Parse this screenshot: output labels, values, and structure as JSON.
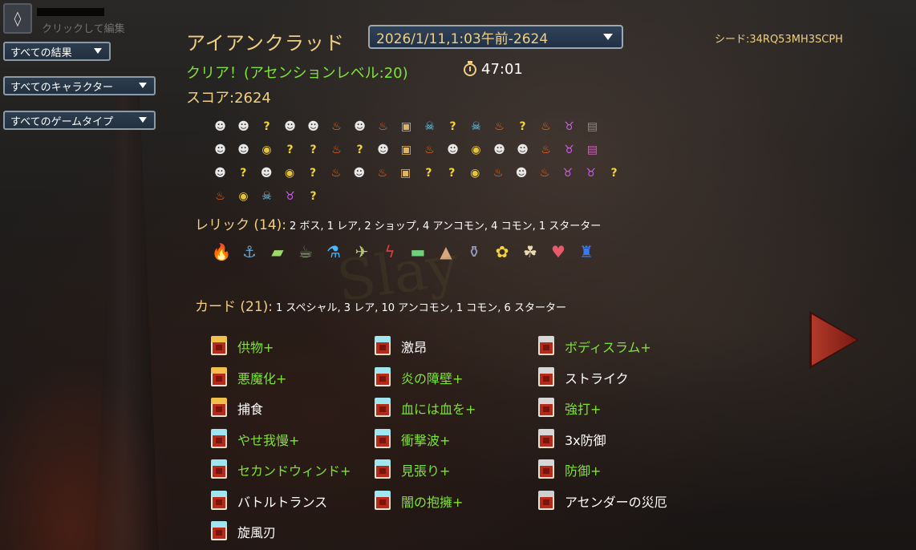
{
  "profile": {
    "edit_hint": "クリックして編集"
  },
  "filters": [
    {
      "label": "すべての結果"
    },
    {
      "label": "すべてのキャラクター"
    },
    {
      "label": "すべてのゲームタイプ"
    }
  ],
  "run": {
    "character": "アイアンクラッド",
    "selected_run": "2026/1/11,1:03午前-2624",
    "seed": "シード:34RQ53MH3SCPH",
    "result": "クリア！(アセンションレベル:20)",
    "time": "47:01",
    "score": "スコア:2624"
  },
  "path_rows": [
    [
      "monster",
      "monster",
      "unknown",
      "monster",
      "monster",
      "rest",
      "monster",
      "rest",
      "treasure",
      "elite",
      "unknown",
      "elite",
      "rest",
      "unknown-monster",
      "rest",
      "boss",
      "chest"
    ],
    [
      "monster",
      "monster",
      "shop",
      "unknown",
      "unknown",
      "rest",
      "unknown",
      "monster",
      "treasure",
      "rest",
      "monster",
      "shop",
      "monster",
      "monster",
      "rest",
      "boss",
      "chest"
    ],
    [
      "monster",
      "unknown",
      "monster",
      "shop",
      "unknown",
      "rest",
      "monster",
      "rest",
      "treasure",
      "unknown",
      "unknown",
      "shop",
      "rest",
      "monster",
      "rest",
      "boss",
      "boss",
      "unknown"
    ],
    [
      "rest",
      "shop",
      "elite",
      "boss",
      "unknown"
    ]
  ],
  "relics_section": {
    "label": "レリック (14):",
    "detail": "2 ボス, 1 レア, 2 ショップ, 4 アンコモン, 4 コモン, 1 スターター"
  },
  "relics": [
    "burning-blood-relic",
    "anchor-relic",
    "gold-bar-relic",
    "teapot-relic",
    "potion-relic",
    "bird-relic",
    "lightning-relic",
    "banner-relic",
    "pyramid-relic",
    "jar-relic",
    "flower-relic",
    "ginger-relic",
    "book-relic",
    "stool-relic"
  ],
  "cards_section": {
    "label": "カード (21):",
    "detail": "1 スペシャル, 3 レア, 10 アンコモン, 1 コモン, 6 スターター"
  },
  "cards": {
    "col1": [
      {
        "name": "供物+",
        "rarity": "rare",
        "upgraded": true
      },
      {
        "name": "悪魔化+",
        "rarity": "rare",
        "upgraded": true
      },
      {
        "name": "捕食",
        "rarity": "rare",
        "upgraded": false
      },
      {
        "name": "やせ我慢+",
        "rarity": "uncommon",
        "upgraded": true
      },
      {
        "name": "セカンドウィンド+",
        "rarity": "uncommon",
        "upgraded": true
      },
      {
        "name": "バトルトランス",
        "rarity": "uncommon",
        "upgraded": false
      },
      {
        "name": "旋風刃",
        "rarity": "uncommon",
        "upgraded": false
      }
    ],
    "col2": [
      {
        "name": "激昂",
        "rarity": "uncommon",
        "upgraded": false
      },
      {
        "name": "炎の障壁+",
        "rarity": "uncommon",
        "upgraded": true
      },
      {
        "name": "血には血を+",
        "rarity": "uncommon",
        "upgraded": true
      },
      {
        "name": "衝撃波+",
        "rarity": "uncommon",
        "upgraded": true
      },
      {
        "name": "見張り+",
        "rarity": "uncommon",
        "upgraded": true
      },
      {
        "name": "闇の抱擁+",
        "rarity": "uncommon",
        "upgraded": true
      }
    ],
    "col3": [
      {
        "name": "ボディスラム+",
        "rarity": "common",
        "upgraded": true
      },
      {
        "name": "ストライク",
        "rarity": "common",
        "upgraded": false
      },
      {
        "name": "強打+",
        "rarity": "common",
        "upgraded": true
      },
      {
        "name": "3x防御",
        "rarity": "common",
        "upgraded": false
      },
      {
        "name": "防御+",
        "rarity": "common",
        "upgraded": true
      },
      {
        "name": "アセンダーの災厄",
        "rarity": "special",
        "upgraded": false
      }
    ]
  },
  "colors": {
    "gold": "#f0cf84",
    "upgraded_green": "#7fe23a"
  }
}
